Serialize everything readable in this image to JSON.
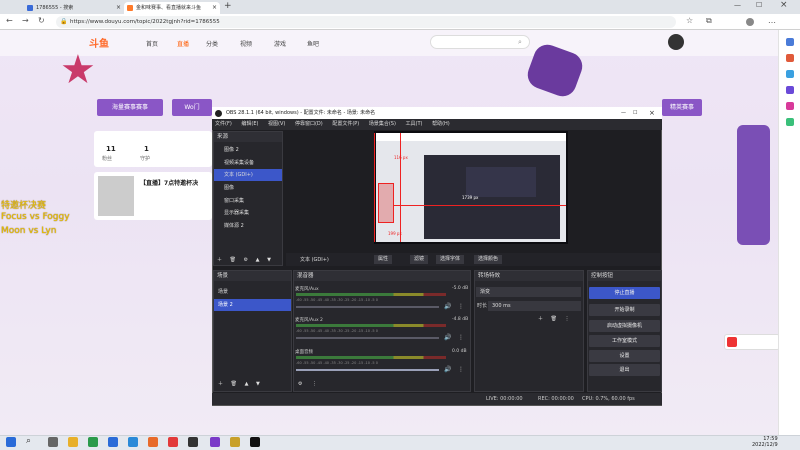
{
  "browser": {
    "tabs": [
      {
        "label": "1786555 - 搜索"
      },
      {
        "label": "金和味赛事、看直播就来斗鱼"
      }
    ],
    "url": "https://www.douyu.com/topic/2022tgjnh?rid=1786555"
  },
  "site": {
    "logo": "斗鱼",
    "nav": [
      "首页",
      "直播",
      "分类",
      "视频",
      "游戏",
      "鱼吧"
    ],
    "promo_buttons": [
      "海量赛事赛事",
      "Wo门",
      "精英赛事"
    ],
    "stats": [
      {
        "value": "11",
        "label": "粉丝"
      },
      {
        "value": "1",
        "label": "守护"
      }
    ],
    "stream_title": "【直播】7点特邀杯决",
    "overlay_lines": [
      "特邀杯决赛",
      "Focus vs Foggy",
      "Moon vs Lyn"
    ]
  },
  "obs": {
    "title": "OBS 28.1.1 (64 bit, windows) - 配置文件: 未命名 - 场景: 未命名",
    "menu": [
      "文件(F)",
      "编辑(E)",
      "视图(V)",
      "停靠窗口(D)",
      "配置文件(P)",
      "场景集合(S)",
      "工具(T)",
      "帮助(H)"
    ],
    "sources_title": "来源",
    "sources": [
      "图像 2",
      "视频采集设备",
      "文本 (GDI+)",
      "图像",
      "窗口采集",
      "显示器采集",
      "媒体源 2"
    ],
    "selected_source": "文本 (GDI+)",
    "scenes_title": "场景",
    "scenes": [
      "场景",
      "场景 2"
    ],
    "preview_toolbar": {
      "label": "文本 (GDI+)",
      "buttons": [
        "属性",
        "滤镜",
        "选择字体",
        "选择颜色"
      ]
    },
    "mixer_title": "混音器",
    "mixer": [
      {
        "name": "麦克风/Aux",
        "db": "-5.0 dB"
      },
      {
        "name": "麦克风/Aux 2",
        "db": "-4.8 dB"
      },
      {
        "name": "桌面音频",
        "db": "0.0 dB"
      }
    ],
    "mixer_scale": "-60 -55 -50 -45 -40 -35 -30 -25 -20 -15 -10 -5 0",
    "transitions_title": "转场特效",
    "transition_type": "渐变",
    "transition_duration_label": "时长",
    "transition_duration": "300 ms",
    "controls_title": "控制按钮",
    "controls": [
      "停止直播",
      "开始录制",
      "启动虚拟摄像机",
      "工作室模式",
      "设置",
      "退出"
    ],
    "preview_size_label": "1739 px",
    "preview_size_label2": "199 px",
    "preview_size_label3": "116 px",
    "status": {
      "live": "LIVE: 00:00:00",
      "rec": "REC: 00:00:00",
      "cpu": "CPU: 0.7%, 60.00 fps"
    }
  },
  "taskbar": {
    "time": "17:59",
    "date": "2022/12/9"
  },
  "colors": {
    "accent": "#3c57c9",
    "site_purple": "#8a56c6",
    "obs_bg": "#1e1e22"
  }
}
